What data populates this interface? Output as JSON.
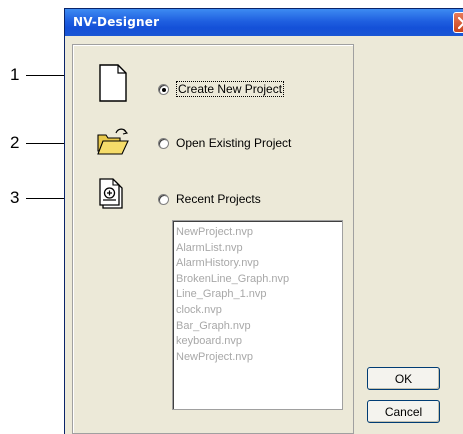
{
  "window": {
    "title": "NV-Designer",
    "close_icon": "close-icon"
  },
  "callouts": [
    "1",
    "2",
    "3"
  ],
  "options": [
    {
      "label": "Create New Project",
      "checked": true,
      "icon": "new-document-icon"
    },
    {
      "label": "Open Existing Project",
      "checked": false,
      "icon": "open-folder-icon"
    },
    {
      "label": "Recent Projects",
      "checked": false,
      "icon": "recent-document-icon"
    }
  ],
  "recent_projects": [
    "NewProject.nvp",
    "AlarmList.nvp",
    "AlarmHistory.nvp",
    "BrokenLine_Graph.nvp",
    "Line_Graph_1.nvp",
    "clock.nvp",
    "Bar_Graph.nvp",
    "keyboard.nvp",
    "NewProject.nvp"
  ],
  "buttons": {
    "ok": "OK",
    "cancel": "Cancel"
  },
  "colors": {
    "titlebar": "#1f5fe0",
    "dialog_bg": "#ece9d8",
    "disabled_text": "#a8a8a8"
  }
}
